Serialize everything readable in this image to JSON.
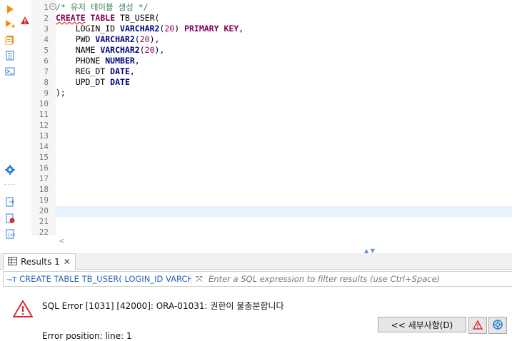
{
  "editor": {
    "line_numbers": [
      "1",
      "2",
      "3",
      "4",
      "5",
      "6",
      "7",
      "8",
      "9",
      "10",
      "11",
      "12",
      "13",
      "14",
      "15",
      "16",
      "17",
      "18",
      "19",
      "20",
      "21",
      "22"
    ],
    "lines": [
      [
        {
          "t": "/* 유저 테이블 생성 */",
          "c": "cm"
        }
      ],
      [
        {
          "t": "CREATE",
          "c": "kw"
        },
        {
          "t": " ",
          "c": "id"
        },
        {
          "t": "TABLE",
          "c": "kw"
        },
        {
          "t": " TB_USER(",
          "c": "id"
        }
      ],
      [
        {
          "t": "    LOGIN_ID ",
          "c": "id"
        },
        {
          "t": "VARCHAR2",
          "c": "ty"
        },
        {
          "t": "(",
          "c": "id"
        },
        {
          "t": "20",
          "c": "num"
        },
        {
          "t": ") ",
          "c": "id"
        },
        {
          "t": "PRIMARY KEY",
          "c": "kw"
        },
        {
          "t": ",",
          "c": "id"
        }
      ],
      [
        {
          "t": "    PWD ",
          "c": "id"
        },
        {
          "t": "VARCHAR2",
          "c": "ty"
        },
        {
          "t": "(",
          "c": "id"
        },
        {
          "t": "20",
          "c": "num"
        },
        {
          "t": "),",
          "c": "id"
        }
      ],
      [
        {
          "t": "    NAME ",
          "c": "id"
        },
        {
          "t": "VARCHAR2",
          "c": "ty"
        },
        {
          "t": "(",
          "c": "id"
        },
        {
          "t": "20",
          "c": "num"
        },
        {
          "t": "),",
          "c": "id"
        }
      ],
      [
        {
          "t": "    PHONE ",
          "c": "id"
        },
        {
          "t": "NUMBER",
          "c": "ty"
        },
        {
          "t": ",",
          "c": "id"
        }
      ],
      [
        {
          "t": "    REG_DT ",
          "c": "id"
        },
        {
          "t": "DATE",
          "c": "ty"
        },
        {
          "t": ",",
          "c": "id"
        }
      ],
      [
        {
          "t": "    UPD_DT ",
          "c": "id"
        },
        {
          "t": "DATE",
          "c": "ty"
        }
      ],
      [
        {
          "t": ");",
          "c": "id"
        }
      ]
    ]
  },
  "results": {
    "tab_label": "Results 1",
    "query_text": "CREATE TABLE TB_USER( LOGIN_ID VARCH",
    "filter_placeholder": "Enter a SQL expression to filter results (use Ctrl+Space)",
    "error_message": "SQL Error [1031] [42000]: ORA-01031: 권한이 불충분합니다",
    "error_position": "Error position: line: 1",
    "details_button": "<< 세부사항(D)"
  },
  "colors": {
    "keyword": "#7f0055",
    "type": "#000080",
    "comment": "#3f7f5f",
    "current_line": "#e8f2fe",
    "error": "#d32f2f",
    "accent": "#2a63b5"
  }
}
